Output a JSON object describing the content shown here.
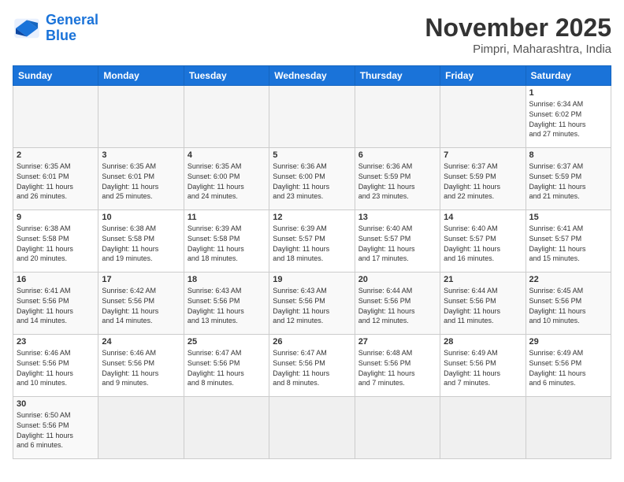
{
  "header": {
    "logo_general": "General",
    "logo_blue": "Blue",
    "month_title": "November 2025",
    "subtitle": "Pimpri, Maharashtra, India"
  },
  "days_of_week": [
    "Sunday",
    "Monday",
    "Tuesday",
    "Wednesday",
    "Thursday",
    "Friday",
    "Saturday"
  ],
  "weeks": [
    [
      {
        "day": "",
        "info": ""
      },
      {
        "day": "",
        "info": ""
      },
      {
        "day": "",
        "info": ""
      },
      {
        "day": "",
        "info": ""
      },
      {
        "day": "",
        "info": ""
      },
      {
        "day": "",
        "info": ""
      },
      {
        "day": "1",
        "info": "Sunrise: 6:34 AM\nSunset: 6:02 PM\nDaylight: 11 hours\nand 27 minutes."
      }
    ],
    [
      {
        "day": "2",
        "info": "Sunrise: 6:35 AM\nSunset: 6:01 PM\nDaylight: 11 hours\nand 26 minutes."
      },
      {
        "day": "3",
        "info": "Sunrise: 6:35 AM\nSunset: 6:01 PM\nDaylight: 11 hours\nand 25 minutes."
      },
      {
        "day": "4",
        "info": "Sunrise: 6:35 AM\nSunset: 6:00 PM\nDaylight: 11 hours\nand 24 minutes."
      },
      {
        "day": "5",
        "info": "Sunrise: 6:36 AM\nSunset: 6:00 PM\nDaylight: 11 hours\nand 23 minutes."
      },
      {
        "day": "6",
        "info": "Sunrise: 6:36 AM\nSunset: 5:59 PM\nDaylight: 11 hours\nand 23 minutes."
      },
      {
        "day": "7",
        "info": "Sunrise: 6:37 AM\nSunset: 5:59 PM\nDaylight: 11 hours\nand 22 minutes."
      },
      {
        "day": "8",
        "info": "Sunrise: 6:37 AM\nSunset: 5:59 PM\nDaylight: 11 hours\nand 21 minutes."
      }
    ],
    [
      {
        "day": "9",
        "info": "Sunrise: 6:38 AM\nSunset: 5:58 PM\nDaylight: 11 hours\nand 20 minutes."
      },
      {
        "day": "10",
        "info": "Sunrise: 6:38 AM\nSunset: 5:58 PM\nDaylight: 11 hours\nand 19 minutes."
      },
      {
        "day": "11",
        "info": "Sunrise: 6:39 AM\nSunset: 5:58 PM\nDaylight: 11 hours\nand 18 minutes."
      },
      {
        "day": "12",
        "info": "Sunrise: 6:39 AM\nSunset: 5:57 PM\nDaylight: 11 hours\nand 18 minutes."
      },
      {
        "day": "13",
        "info": "Sunrise: 6:40 AM\nSunset: 5:57 PM\nDaylight: 11 hours\nand 17 minutes."
      },
      {
        "day": "14",
        "info": "Sunrise: 6:40 AM\nSunset: 5:57 PM\nDaylight: 11 hours\nand 16 minutes."
      },
      {
        "day": "15",
        "info": "Sunrise: 6:41 AM\nSunset: 5:57 PM\nDaylight: 11 hours\nand 15 minutes."
      }
    ],
    [
      {
        "day": "16",
        "info": "Sunrise: 6:41 AM\nSunset: 5:56 PM\nDaylight: 11 hours\nand 14 minutes."
      },
      {
        "day": "17",
        "info": "Sunrise: 6:42 AM\nSunset: 5:56 PM\nDaylight: 11 hours\nand 14 minutes."
      },
      {
        "day": "18",
        "info": "Sunrise: 6:43 AM\nSunset: 5:56 PM\nDaylight: 11 hours\nand 13 minutes."
      },
      {
        "day": "19",
        "info": "Sunrise: 6:43 AM\nSunset: 5:56 PM\nDaylight: 11 hours\nand 12 minutes."
      },
      {
        "day": "20",
        "info": "Sunrise: 6:44 AM\nSunset: 5:56 PM\nDaylight: 11 hours\nand 12 minutes."
      },
      {
        "day": "21",
        "info": "Sunrise: 6:44 AM\nSunset: 5:56 PM\nDaylight: 11 hours\nand 11 minutes."
      },
      {
        "day": "22",
        "info": "Sunrise: 6:45 AM\nSunset: 5:56 PM\nDaylight: 11 hours\nand 10 minutes."
      }
    ],
    [
      {
        "day": "23",
        "info": "Sunrise: 6:46 AM\nSunset: 5:56 PM\nDaylight: 11 hours\nand 10 minutes."
      },
      {
        "day": "24",
        "info": "Sunrise: 6:46 AM\nSunset: 5:56 PM\nDaylight: 11 hours\nand 9 minutes."
      },
      {
        "day": "25",
        "info": "Sunrise: 6:47 AM\nSunset: 5:56 PM\nDaylight: 11 hours\nand 8 minutes."
      },
      {
        "day": "26",
        "info": "Sunrise: 6:47 AM\nSunset: 5:56 PM\nDaylight: 11 hours\nand 8 minutes."
      },
      {
        "day": "27",
        "info": "Sunrise: 6:48 AM\nSunset: 5:56 PM\nDaylight: 11 hours\nand 7 minutes."
      },
      {
        "day": "28",
        "info": "Sunrise: 6:49 AM\nSunset: 5:56 PM\nDaylight: 11 hours\nand 7 minutes."
      },
      {
        "day": "29",
        "info": "Sunrise: 6:49 AM\nSunset: 5:56 PM\nDaylight: 11 hours\nand 6 minutes."
      }
    ],
    [
      {
        "day": "30",
        "info": "Sunrise: 6:50 AM\nSunset: 5:56 PM\nDaylight: 11 hours\nand 6 minutes."
      },
      {
        "day": "",
        "info": ""
      },
      {
        "day": "",
        "info": ""
      },
      {
        "day": "",
        "info": ""
      },
      {
        "day": "",
        "info": ""
      },
      {
        "day": "",
        "info": ""
      },
      {
        "day": "",
        "info": ""
      }
    ]
  ]
}
